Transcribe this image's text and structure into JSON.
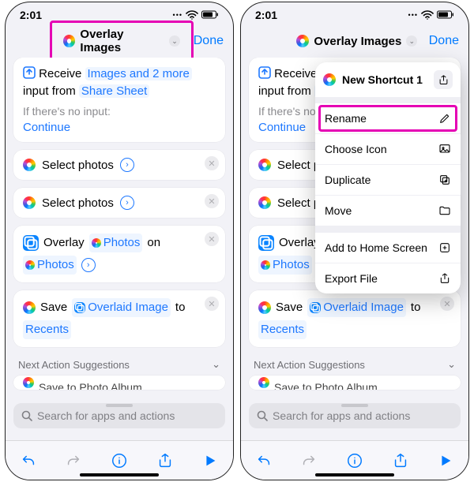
{
  "status": {
    "time": "2:01"
  },
  "header": {
    "title": "Overlay Images",
    "done": "Done"
  },
  "receive": {
    "word_receive": "Receive",
    "token_main": "Images and 2 more",
    "word_input_from": "input from",
    "token_source": "Share Sheet",
    "no_input_label": "If there's no input:",
    "continue": "Continue"
  },
  "actions": {
    "select_photos": "Select photos",
    "overlay_word": "Overlay",
    "photos_token": "Photos",
    "on_word": "on",
    "save_word": "Save",
    "overlaid_token": "Overlaid Image",
    "to_word": "to",
    "recents_token": "Recents"
  },
  "suggestions": {
    "header": "Next Action Suggestions",
    "item_peek": "Save to Photo Album"
  },
  "search": {
    "placeholder": "Search for apps and actions"
  },
  "popover": {
    "title": "New Shortcut 1",
    "rename": "Rename",
    "choose_icon": "Choose Icon",
    "duplicate": "Duplicate",
    "move": "Move",
    "add_home": "Add to Home Screen",
    "export": "Export File"
  }
}
